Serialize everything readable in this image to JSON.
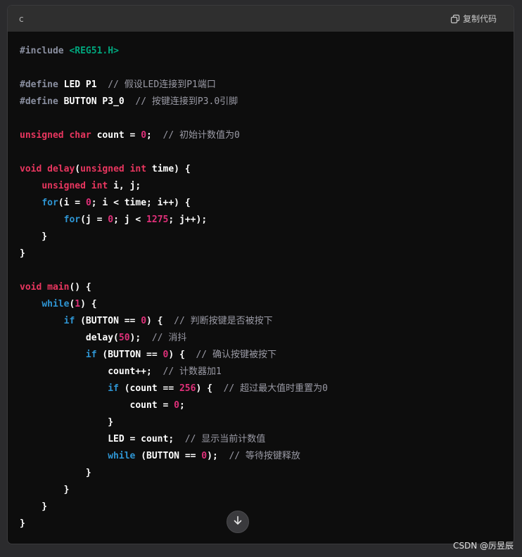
{
  "code_block": {
    "language": "c",
    "copy_label": "复制代码",
    "lines": [
      [
        {
          "t": "#include ",
          "c": "kw-pre"
        },
        {
          "t": "<REG51.H>",
          "c": "str-green"
        }
      ],
      [],
      [
        {
          "t": "#define",
          "c": "kw-pre"
        },
        {
          "t": " LED P1  ",
          "c": "plain"
        },
        {
          "t": "// 假设LED连接到P1端口",
          "c": "cmt"
        }
      ],
      [
        {
          "t": "#define",
          "c": "kw-pre"
        },
        {
          "t": " BUTTON P3_0  ",
          "c": "plain"
        },
        {
          "t": "// 按键连接到P3.0引脚",
          "c": "cmt"
        }
      ],
      [],
      [
        {
          "t": "unsigned",
          "c": "kw-pink"
        },
        {
          "t": " ",
          "c": "plain"
        },
        {
          "t": "char",
          "c": "kw-pink"
        },
        {
          "t": " count = ",
          "c": "plain"
        },
        {
          "t": "0",
          "c": "num"
        },
        {
          "t": ";  ",
          "c": "plain"
        },
        {
          "t": "// 初始计数值为0",
          "c": "cmt"
        }
      ],
      [],
      [
        {
          "t": "void",
          "c": "kw-pink"
        },
        {
          "t": " ",
          "c": "plain"
        },
        {
          "t": "delay",
          "c": "kw-pink"
        },
        {
          "t": "(",
          "c": "plain"
        },
        {
          "t": "unsigned",
          "c": "kw-pink"
        },
        {
          "t": " ",
          "c": "plain"
        },
        {
          "t": "int",
          "c": "kw-pink"
        },
        {
          "t": " time) {",
          "c": "plain"
        }
      ],
      [
        {
          "t": "    ",
          "c": "plain"
        },
        {
          "t": "unsigned",
          "c": "kw-pink"
        },
        {
          "t": " ",
          "c": "plain"
        },
        {
          "t": "int",
          "c": "kw-pink"
        },
        {
          "t": " i, j;",
          "c": "plain"
        }
      ],
      [
        {
          "t": "    ",
          "c": "plain"
        },
        {
          "t": "for",
          "c": "kw-blue"
        },
        {
          "t": "(i = ",
          "c": "plain"
        },
        {
          "t": "0",
          "c": "num"
        },
        {
          "t": "; i < time; i++) {",
          "c": "plain"
        }
      ],
      [
        {
          "t": "        ",
          "c": "plain"
        },
        {
          "t": "for",
          "c": "kw-blue"
        },
        {
          "t": "(j = ",
          "c": "plain"
        },
        {
          "t": "0",
          "c": "num"
        },
        {
          "t": "; j < ",
          "c": "plain"
        },
        {
          "t": "1275",
          "c": "num"
        },
        {
          "t": "; j++);",
          "c": "plain"
        }
      ],
      [
        {
          "t": "    }",
          "c": "plain"
        }
      ],
      [
        {
          "t": "}",
          "c": "plain"
        }
      ],
      [],
      [
        {
          "t": "void",
          "c": "kw-pink"
        },
        {
          "t": " ",
          "c": "plain"
        },
        {
          "t": "main",
          "c": "kw-pink"
        },
        {
          "t": "() {",
          "c": "plain"
        }
      ],
      [
        {
          "t": "    ",
          "c": "plain"
        },
        {
          "t": "while",
          "c": "kw-blue"
        },
        {
          "t": "(",
          "c": "plain"
        },
        {
          "t": "1",
          "c": "num"
        },
        {
          "t": ") {",
          "c": "plain"
        }
      ],
      [
        {
          "t": "        ",
          "c": "plain"
        },
        {
          "t": "if",
          "c": "kw-blue"
        },
        {
          "t": " (BUTTON == ",
          "c": "plain"
        },
        {
          "t": "0",
          "c": "num"
        },
        {
          "t": ") {  ",
          "c": "plain"
        },
        {
          "t": "// 判断按键是否被按下",
          "c": "cmt"
        }
      ],
      [
        {
          "t": "            delay(",
          "c": "plain"
        },
        {
          "t": "50",
          "c": "num"
        },
        {
          "t": ");  ",
          "c": "plain"
        },
        {
          "t": "// 消抖",
          "c": "cmt"
        }
      ],
      [
        {
          "t": "            ",
          "c": "plain"
        },
        {
          "t": "if",
          "c": "kw-blue"
        },
        {
          "t": " (BUTTON == ",
          "c": "plain"
        },
        {
          "t": "0",
          "c": "num"
        },
        {
          "t": ") {  ",
          "c": "plain"
        },
        {
          "t": "// 确认按键被按下",
          "c": "cmt"
        }
      ],
      [
        {
          "t": "                count++;  ",
          "c": "plain"
        },
        {
          "t": "// 计数器加1",
          "c": "cmt"
        }
      ],
      [
        {
          "t": "                ",
          "c": "plain"
        },
        {
          "t": "if",
          "c": "kw-blue"
        },
        {
          "t": " (count == ",
          "c": "plain"
        },
        {
          "t": "256",
          "c": "num"
        },
        {
          "t": ") {  ",
          "c": "plain"
        },
        {
          "t": "// 超过最大值时重置为0",
          "c": "cmt"
        }
      ],
      [
        {
          "t": "                    count = ",
          "c": "plain"
        },
        {
          "t": "0",
          "c": "num"
        },
        {
          "t": ";",
          "c": "plain"
        }
      ],
      [
        {
          "t": "                }",
          "c": "plain"
        }
      ],
      [
        {
          "t": "                LED = count;  ",
          "c": "plain"
        },
        {
          "t": "// 显示当前计数值",
          "c": "cmt"
        }
      ],
      [
        {
          "t": "                ",
          "c": "plain"
        },
        {
          "t": "while",
          "c": "kw-blue"
        },
        {
          "t": " (BUTTON == ",
          "c": "plain"
        },
        {
          "t": "0",
          "c": "num"
        },
        {
          "t": ");  ",
          "c": "plain"
        },
        {
          "t": "// 等待按键释放",
          "c": "cmt"
        }
      ],
      [
        {
          "t": "            }",
          "c": "plain"
        }
      ],
      [
        {
          "t": "        }",
          "c": "plain"
        }
      ],
      [
        {
          "t": "    }",
          "c": "plain"
        }
      ],
      [
        {
          "t": "}",
          "c": "plain"
        }
      ]
    ]
  },
  "icons": {
    "copy": "copy-icon",
    "scroll_down": "arrow-down-icon"
  },
  "colors": {
    "panel_bg": "#0d0d0d",
    "header_bg": "#2f2f2f",
    "keyword_blue": "#2e95d3",
    "keyword_pink": "#e9365f",
    "string_green": "#00a67d",
    "number": "#df3079",
    "comment": "#9a9aa5"
  },
  "watermark": "CSDN @厉昱辰"
}
